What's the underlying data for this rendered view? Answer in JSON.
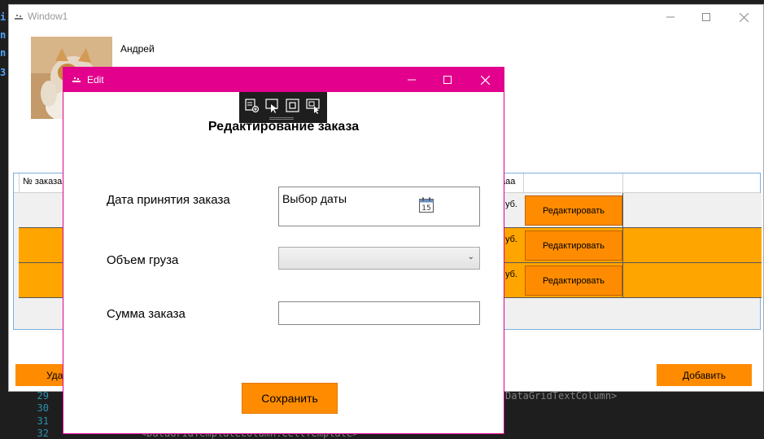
{
  "editor": {
    "line_numbers": [
      "29",
      "30",
      "31",
      "32"
    ],
    "code_fragments": [
      "DataGridTextColumn>",
      "<DataGridTemplateColumn.CellTemplate>"
    ]
  },
  "main_window": {
    "title": "Window1",
    "user_name": "Андрей",
    "grid": {
      "headers": [
        "№ заказа",
        "ааа"
      ],
      "rows": [
        {
          "price": "уб.",
          "edit_label": "Редактировать",
          "bg": "#f0f0f0"
        },
        {
          "price": "уб.",
          "edit_label": "Редактировать",
          "bg": "#ffa500"
        },
        {
          "price": "уб.",
          "edit_label": "Редактировать",
          "bg": "#ffa500"
        }
      ]
    },
    "delete_label": "Удалить",
    "add_label": "Добавить"
  },
  "dialog": {
    "title": "Edit",
    "heading": "Редактирование заказа",
    "date_label": "Дата принятия заказа",
    "date_placeholder": "Выбор даты",
    "calendar_day": "15",
    "volume_label": "Объем груза",
    "volume_value": "",
    "sum_label": "Сумма заказа",
    "sum_value": "",
    "save_label": "Сохранить"
  },
  "colors": {
    "accent": "#ff8c00",
    "dialog_title_bar": "#e3008c",
    "row_orange": "#ffa500"
  },
  "icons": [
    "app-icon",
    "minimize-icon",
    "maximize-icon",
    "close-icon",
    "select-element-icon",
    "pointer-icon",
    "display-layout-icon",
    "track-focus-icon",
    "calendar-icon",
    "chevron-down-icon"
  ]
}
